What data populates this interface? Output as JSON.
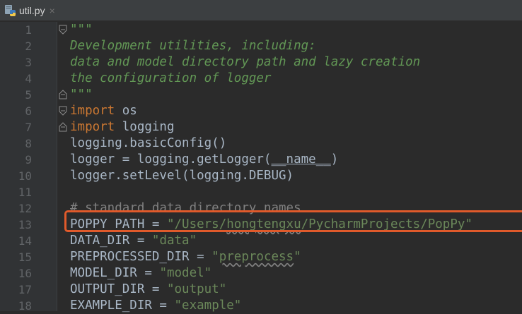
{
  "tab": {
    "filename": "util.py",
    "close_glyph": "×",
    "icon": "python-file-icon"
  },
  "colors": {
    "keyword": "#cc7832",
    "string": "#6a8759",
    "docstring": "#629755",
    "comment": "#808080",
    "text": "#a9b7c6",
    "highlight": "#e05a2b"
  },
  "lines": [
    {
      "n": "1",
      "fold": "open",
      "tokens": [
        {
          "t": "doc",
          "v": "\"\"\""
        }
      ]
    },
    {
      "n": "2",
      "tokens": [
        {
          "t": "doc",
          "v": "Development utilities, including:"
        }
      ]
    },
    {
      "n": "3",
      "tokens": [
        {
          "t": "doc",
          "v": "data and model directory path and lazy creation"
        }
      ]
    },
    {
      "n": "4",
      "tokens": [
        {
          "t": "doc",
          "v": "the configuration of logger"
        }
      ]
    },
    {
      "n": "5",
      "fold": "close",
      "tokens": [
        {
          "t": "doc",
          "v": "\"\"\""
        }
      ]
    },
    {
      "n": "6",
      "fold": "open",
      "tokens": [
        {
          "t": "kw",
          "v": "import"
        },
        {
          "t": "plain",
          "v": " os"
        }
      ]
    },
    {
      "n": "7",
      "fold": "close",
      "tokens": [
        {
          "t": "kw",
          "v": "import"
        },
        {
          "t": "plain",
          "v": " logging"
        }
      ]
    },
    {
      "n": "8",
      "tokens": [
        {
          "t": "plain",
          "v": "logging.basicConfig()"
        }
      ]
    },
    {
      "n": "9",
      "tokens": [
        {
          "t": "plain",
          "v": "logger = logging.getLogger("
        },
        {
          "t": "dunder",
          "v": "__name__"
        },
        {
          "t": "plain",
          "v": ")"
        }
      ]
    },
    {
      "n": "10",
      "tokens": [
        {
          "t": "plain",
          "v": "logger.setLevel(logging.DEBUG)"
        }
      ]
    },
    {
      "n": "11",
      "tokens": []
    },
    {
      "n": "12",
      "tokens": [
        {
          "t": "cmt",
          "v": "# standard data directory names"
        }
      ]
    },
    {
      "n": "13",
      "tokens": [
        {
          "t": "plain",
          "v": "POPPY_PATH = "
        },
        {
          "t": "str",
          "v": "\"/Users/"
        },
        {
          "t": "strsq",
          "v": "hongtengxu"
        },
        {
          "t": "str",
          "v": "/PycharmProjects/PopPy\""
        }
      ]
    },
    {
      "n": "14",
      "tokens": [
        {
          "t": "plain",
          "v": "DATA_DIR = "
        },
        {
          "t": "str",
          "v": "\"data\""
        }
      ]
    },
    {
      "n": "15",
      "tokens": [
        {
          "t": "plain",
          "v": "PREPROCESSED_DIR = "
        },
        {
          "t": "str",
          "v": "\""
        },
        {
          "t": "strsq",
          "v": "preprocess"
        },
        {
          "t": "str",
          "v": "\""
        }
      ]
    },
    {
      "n": "16",
      "tokens": [
        {
          "t": "plain",
          "v": "MODEL_DIR = "
        },
        {
          "t": "str",
          "v": "\"model\""
        }
      ]
    },
    {
      "n": "17",
      "tokens": [
        {
          "t": "plain",
          "v": "OUTPUT_DIR = "
        },
        {
          "t": "str",
          "v": "\"output\""
        }
      ]
    },
    {
      "n": "18",
      "tokens": [
        {
          "t": "plain",
          "v": "EXAMPLE_DIR = "
        },
        {
          "t": "str",
          "v": "\"example\""
        }
      ]
    }
  ]
}
